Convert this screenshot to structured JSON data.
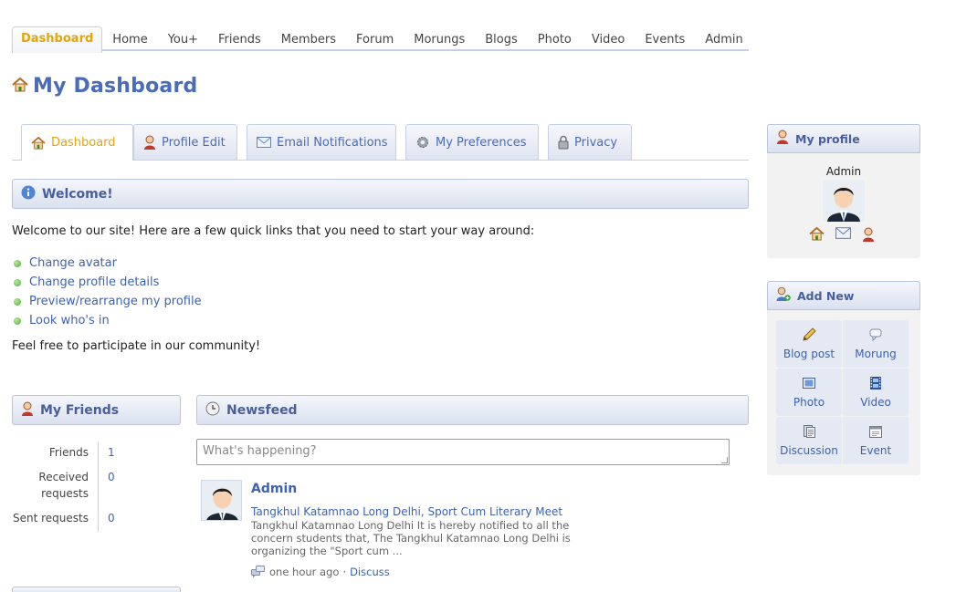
{
  "topnav": {
    "items": [
      "Dashboard",
      "Home",
      "You+",
      "Friends",
      "Members",
      "Forum",
      "Morungs",
      "Blogs",
      "Photo",
      "Video",
      "Events",
      "Admin"
    ],
    "active": "Dashboard"
  },
  "page": {
    "title": "My Dashboard",
    "icon": "home-icon"
  },
  "tabs": [
    {
      "label": "Dashboard",
      "icon": "home-icon"
    },
    {
      "label": "Profile Edit",
      "icon": "user-icon"
    },
    {
      "label": "Email Notifications",
      "icon": "envelope-icon"
    },
    {
      "label": "My Preferences",
      "icon": "gear-icon"
    },
    {
      "label": "Privacy",
      "icon": "lock-icon"
    }
  ],
  "welcome": {
    "title": "Welcome!",
    "intro": "Welcome to our site! Here are a few quick links that you need to start your way around:",
    "links": [
      "Change avatar",
      "Change profile details",
      "Preview/rearrange my profile",
      "Look who's in"
    ],
    "outro": "Feel free to participate in our community!"
  },
  "friends": {
    "title": "My Friends",
    "stats": [
      {
        "label": "Friends",
        "value": "1"
      },
      {
        "label": "Received requests",
        "value": "0"
      },
      {
        "label": "Sent requests",
        "value": "0"
      }
    ]
  },
  "newsfeed": {
    "title": "Newsfeed",
    "placeholder": "What's happening?",
    "item": {
      "author": "Admin",
      "title": "Tangkhul Katamnao Long Delhi, Sport Cum Literary Meet",
      "body": "Tangkhul Katamnao Long Delhi It is hereby notified to all the concern students that, The Tangkhul Katamnao Long Delhi is organizing the \"Sport cum ...",
      "time": "one hour ago",
      "separator": "·",
      "action": "Discuss"
    }
  },
  "profile": {
    "title": "My profile",
    "name": "Admin"
  },
  "addnew": {
    "title": "Add New",
    "items": [
      {
        "label": "Blog post",
        "icon": "pencil-icon"
      },
      {
        "label": "Morung",
        "icon": "speech-bubble-icon"
      },
      {
        "label": "Photo",
        "icon": "photo-icon"
      },
      {
        "label": "Video",
        "icon": "film-icon"
      },
      {
        "label": "Discussion",
        "icon": "document-icon"
      },
      {
        "label": "Event",
        "icon": "calendar-icon"
      }
    ]
  },
  "colors": {
    "accent": "#e5a60a",
    "link": "#3e62b0",
    "heading": "#4a6bb8",
    "panel": "#dbe1f0"
  }
}
